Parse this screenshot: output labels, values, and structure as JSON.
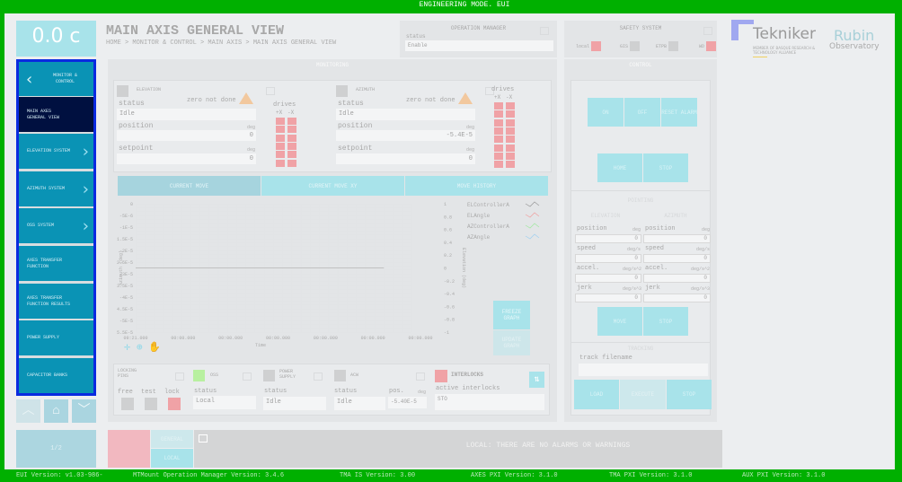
{
  "top_title": "ENGINEERING MODE. EUI",
  "time_display": "0.0 c",
  "header": {
    "title": "MAIN AXIS GENERAL VIEW",
    "breadcrumb": "HOME > MONITOR & CONTROL > MAIN AXIS > MAIN AXIS GENERAL VIEW"
  },
  "sidebar": {
    "back": "MONITOR & CONTROL",
    "items": [
      {
        "label": "MAIN AXES GENERAL VIEW",
        "active": true
      },
      {
        "label": "ELEVATION SYSTEM",
        "chevron": true
      },
      {
        "label": "AZIMUTH SYSTEM",
        "chevron": true
      },
      {
        "label": "OSS SYSTEM",
        "chevron": true
      },
      {
        "label": "AXES TRANSFER FUNCTION"
      },
      {
        "label": "AXES TRANSFER FUNCTION RESULTS"
      },
      {
        "label": "POWER SUPPLY"
      },
      {
        "label": "CAPACITOR BANKS"
      }
    ],
    "page": "1/2"
  },
  "operation_manager": {
    "title": "OPERATION MANAGER",
    "status_label": "status",
    "status": "Enable"
  },
  "safety": {
    "title": "SAFETY SYSTEM",
    "items": [
      {
        "label": "local",
        "state": "red"
      },
      {
        "label": "GIS",
        "state": "gray"
      },
      {
        "label": "ETPB",
        "state": "gray"
      },
      {
        "label": "WD",
        "state": "red"
      }
    ]
  },
  "logos": {
    "tekniker": "Tekniker",
    "tekniker_sub": "MEMBER OF BASQUE RESEARCH & TECHNOLOGY ALLIANCE",
    "rubin": "Rubin",
    "rubin_sub": "Observatory"
  },
  "monitoring": {
    "title": "MONITORING",
    "elevation": {
      "title": "ELEVATION",
      "warning": "zero not done",
      "status_label": "status",
      "status": "Idle",
      "position_label": "position",
      "position": "0",
      "setpoint_label": "setpoint",
      "setpoint": "0",
      "unit": "deg",
      "drives_label": "drives",
      "drive_cols": [
        "+X",
        "-X"
      ]
    },
    "azimuth": {
      "title": "AZIMUTH",
      "warning": "zero not done",
      "status_label": "status",
      "status": "Idle",
      "position_label": "position",
      "position": "-5.4E-5",
      "setpoint_label": "setpoint",
      "setpoint": "0",
      "unit": "deg",
      "drives_label": "drives",
      "drive_cols": [
        "+X",
        "-X"
      ]
    },
    "tabs": [
      "CURRENT MOVE",
      "CURRENT MOVE XY",
      "MOVE HISTORY"
    ],
    "freeze": "FREEZE GRAPH",
    "update": "UPDATE GRAPH",
    "locking": {
      "title": "LOCKING PINS",
      "labels": [
        "free",
        "test",
        "lock"
      ]
    },
    "oss": {
      "title": "OSS",
      "status_label": "status",
      "status": "Local"
    },
    "power": {
      "title": "POWER SUPPLY",
      "status_label": "status",
      "status": "Idle"
    },
    "acw": {
      "title": "ACW",
      "status_label": "status",
      "status": "Idle",
      "pos_label": "pos.",
      "pos_unit": "deg",
      "pos": "-5.40E-5"
    },
    "interlocks": {
      "title": "INTERLOCKS",
      "active_label": "active interlocks",
      "active": "STO"
    }
  },
  "chart_data": {
    "type": "line",
    "xlabel": "Time",
    "ylabel": "Azimuth (deg)",
    "y2label": "Elevation (deg)",
    "x_ticks": [
      "09:21.000",
      "00:00.000",
      "00:00.000",
      "00:00.000",
      "00:00.000",
      "00:00.000",
      "00:00.000"
    ],
    "y_ticks": [
      "0",
      "-5E-6",
      "-1E-5",
      "-1.5E-5",
      "-2E-5",
      "-2.5E-5",
      "-3E-5",
      "-3.5E-5",
      "-4E-5",
      "-4.5E-5",
      "-5E-5",
      "-5.5E-5"
    ],
    "y2_ticks": [
      "1",
      "0.8",
      "0.6",
      "0.4",
      "0.2",
      "0",
      "-0.2",
      "-0.4",
      "-0.6",
      "-0.8",
      "-1"
    ],
    "ylim": [
      -5.5e-05,
      0
    ],
    "y2lim": [
      -1,
      1
    ],
    "grid": true,
    "legend": "right",
    "series": [
      {
        "name": "ELControllerA",
        "color": "#9a9a9a"
      },
      {
        "name": "ELAngle",
        "color": "#f0a0a0",
        "values_elevation": [
          0,
          0
        ]
      },
      {
        "name": "AZControllerA",
        "color": "#a0e8a0"
      },
      {
        "name": "AZAngle",
        "color": "#a0d0f0"
      }
    ]
  },
  "control": {
    "title": "CONTROL",
    "on": "ON",
    "off": "OFF",
    "reset": "RESET ALARM",
    "home": "HOME",
    "stop": "STOP",
    "pointing": "POINTING",
    "el": "ELEVATION",
    "az": "AZIMUTH",
    "rows": [
      {
        "label": "position",
        "unit": "deg",
        "el": "0",
        "az": "0"
      },
      {
        "label": "speed",
        "unit": "deg/s",
        "el": "0",
        "az": "0"
      },
      {
        "label": "accel.",
        "unit": "deg/s^2",
        "el": "0",
        "az": "0"
      },
      {
        "label": "jerk",
        "unit": "deg/s^3",
        "el": "0",
        "az": "0"
      }
    ],
    "move": "MOVE",
    "tracking": "TRACKING",
    "track_label": "track filename",
    "track_value": "",
    "load": "LOAD",
    "execute": "EXECUTE"
  },
  "alarms": {
    "general": "GENERAL",
    "local": "LOCAL",
    "message": "LOCAL: THERE ARE NO ALARMS OR WARNINGS"
  },
  "footer": [
    "EUI Version: v1.03-986-",
    "MTMount Operation Manager Version: 3.4.6",
    "TMA IS Version: 3.00",
    "AXES PXI Version: 3.1.0",
    "TMA PXI Version: 3.1.0",
    "AUX PXI Version: 3.1.0"
  ]
}
